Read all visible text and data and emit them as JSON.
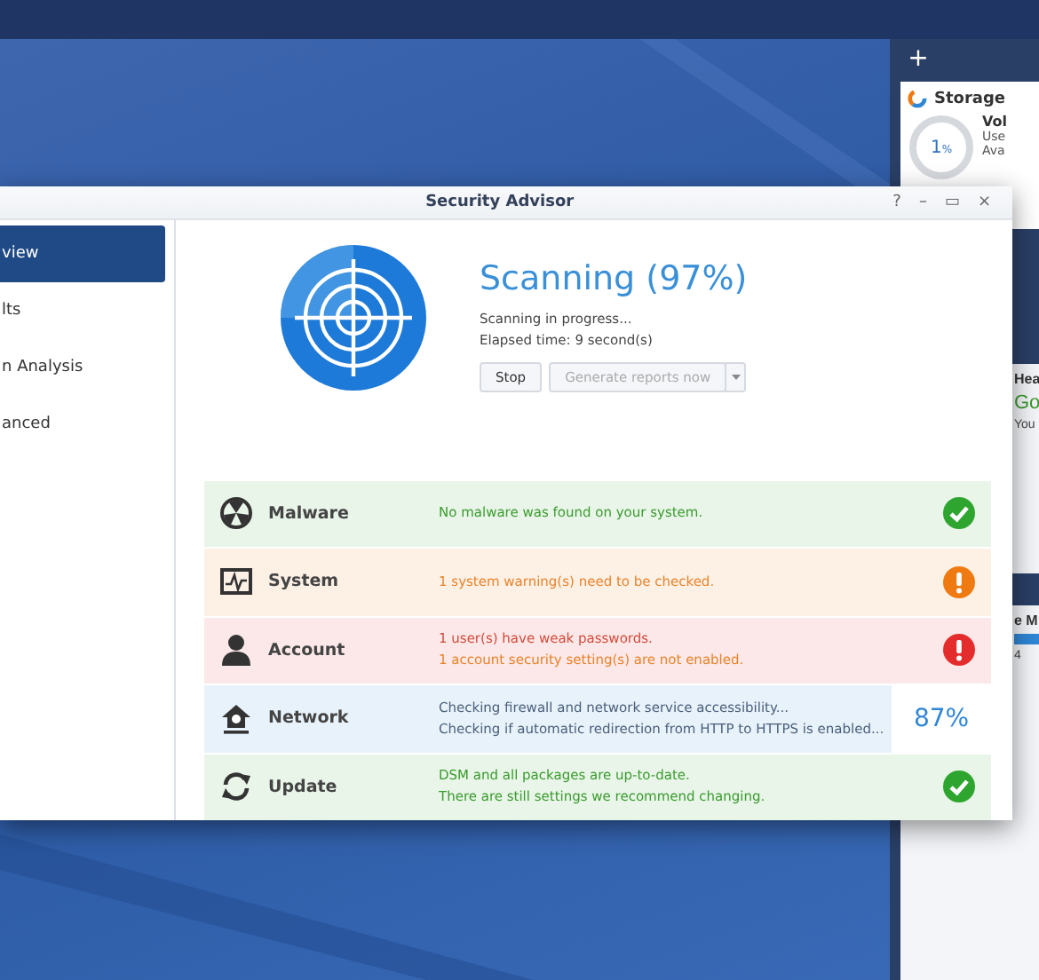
{
  "widgets": {
    "add_label": "+",
    "storage": {
      "title": "Storage",
      "percent": "1",
      "unit": "%",
      "lines": [
        "Vol",
        "Use",
        "Ava"
      ]
    },
    "health": {
      "title": "Hea",
      "status": "Go",
      "line": "You"
    },
    "monitor": {
      "title": "e M",
      "count": "4"
    }
  },
  "window": {
    "title": "Security Advisor",
    "controls": [
      "?",
      "–",
      "▭",
      "×"
    ]
  },
  "sidebar": {
    "items": [
      {
        "label": "view",
        "selected": true
      },
      {
        "label": "lts",
        "selected": false
      },
      {
        "label": "n Analysis",
        "selected": false
      },
      {
        "label": "anced",
        "selected": false
      }
    ]
  },
  "scan": {
    "title": "Scanning (97%)",
    "lines": [
      "Scanning in progress...",
      "Elapsed time: 9 second(s)"
    ],
    "buttons": [
      {
        "label": "Stop",
        "disabled": false
      },
      {
        "label": "Generate reports now",
        "disabled": true
      }
    ]
  },
  "categories": [
    {
      "kind": "malware",
      "name": "Malware",
      "passed": true,
      "color": "#2ea52e",
      "messages": [
        {
          "text": "No malware was found on your system.",
          "color": "#3a9a2e"
        }
      ]
    },
    {
      "kind": "system",
      "name": "System",
      "passed": false,
      "color": "#f07a12",
      "messages": [
        {
          "text": "1 system warning(s) need to be checked.",
          "color": "#e8832a"
        }
      ]
    },
    {
      "kind": "account",
      "name": "Account",
      "passed": false,
      "color": "#e52c2c",
      "messages": [
        {
          "text": "1 user(s) have weak passwords.",
          "color": "#d24a3a"
        },
        {
          "text": "1 account security setting(s) are not enabled.",
          "color": "#e8832a"
        }
      ]
    },
    {
      "kind": "network",
      "name": "Network",
      "color": "#2f86d6",
      "progress": "87%",
      "messages": [
        {
          "text": "Checking firewall and network service accessibility...",
          "color": "#4a5f7a"
        },
        {
          "text": "Checking if automatic redirection from HTTP to HTTPS is enabled...",
          "color": "#4a5f7a"
        }
      ]
    },
    {
      "kind": "update",
      "name": "Update",
      "passed": true,
      "color": "#2ea52e",
      "messages": [
        {
          "text": "DSM and all packages are up-to-date.",
          "color": "#3a9a2e"
        },
        {
          "text": "There are still settings we recommend changing.",
          "color": "#3a9a2e"
        }
      ]
    }
  ]
}
